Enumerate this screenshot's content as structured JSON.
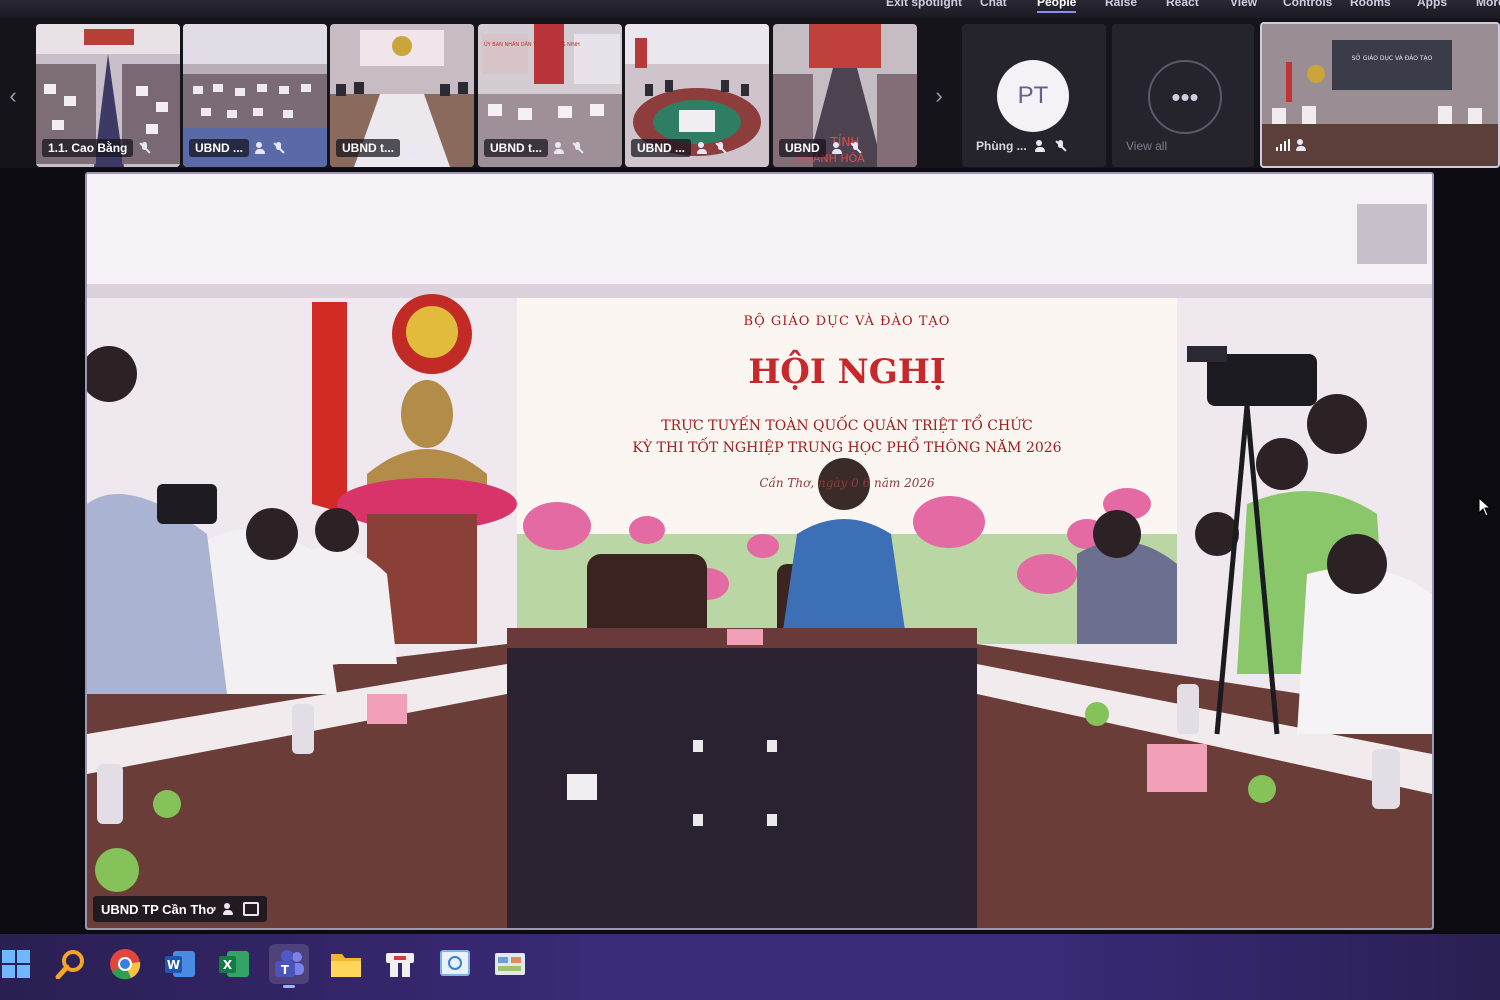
{
  "toolbar": {
    "items": [
      "Exit spotlight",
      "Chat",
      "People",
      "Raise",
      "React",
      "View",
      "Controls",
      "Rooms",
      "Apps",
      "More"
    ],
    "active": "People"
  },
  "participants": [
    {
      "label": "1.1. Cao Bằng"
    },
    {
      "label": "UBND ..."
    },
    {
      "label": "UBND t..."
    },
    {
      "label": "UBND t..."
    },
    {
      "label": "UBND ..."
    },
    {
      "label": "UBND"
    }
  ],
  "thumb_signs": {
    "t4_sign": "ỦY BAN NHÂN DÂN TỈNH QUẢNG NINH",
    "t6_sign_line1": "TỈNH",
    "t6_sign_line2": "KHÁNH HÒA",
    "self_sign": "SỞ GIÁO DỤC VÀ ĐÀO TẠO"
  },
  "avatar_tile": {
    "initials": "PT",
    "label": "Phùng ..."
  },
  "view_all": {
    "icon": "more-icon",
    "label": "View all"
  },
  "spotlight": {
    "participant_label": "UBND TP Cần Thơ",
    "backdrop": {
      "ministry": "BỘ GIÁO DỤC VÀ ĐÀO TẠO",
      "title": "HỘI NGHỊ",
      "subtitle_line1": "TRỰC TUYẾN TOÀN QUỐC QUÁN TRIỆT TỔ CHỨC",
      "subtitle_line2": "KỲ THI TỐT NGHIỆP TRUNG HỌC PHỔ THÔNG NĂM 2026",
      "dateline": "Cần Thơ, ngày 0   6 năm 2026"
    }
  },
  "taskbar": {
    "apps": [
      "start-icon",
      "search-icon",
      "chrome-icon",
      "word-icon",
      "excel-icon",
      "teams-icon",
      "file-explorer-icon",
      "app-icon",
      "app-icon",
      "app-icon"
    ],
    "active": "teams-icon"
  },
  "colors": {
    "accent": "#8f8bf0",
    "taskbar": "#3a2a78",
    "backdrop_red": "#a31d1d"
  }
}
